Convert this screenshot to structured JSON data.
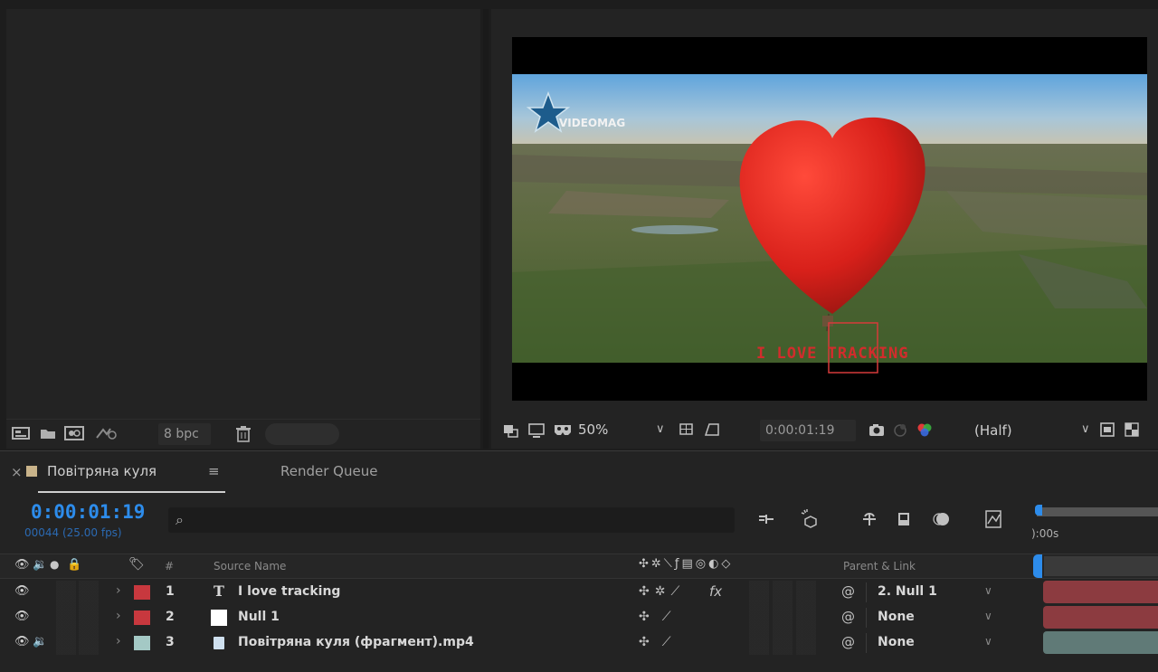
{
  "project_panel": {
    "toolbar": {
      "bpc_label": "8 bpc",
      "icons": [
        "interpret-footage-icon",
        "new-folder-icon",
        "new-composition-icon",
        "flowchart-icon",
        "trash-icon"
      ]
    }
  },
  "viewer": {
    "frame": {
      "logo_text": "VIDEOMAG",
      "overlay_text": "I LOVE TRACKING"
    },
    "toolbar": {
      "zoom": "50%",
      "timecode": "0:00:01:19",
      "resolution": "(Half)"
    }
  },
  "timeline": {
    "tabs": [
      {
        "label": "Повітряна куля"
      },
      {
        "label": "Render Queue"
      }
    ],
    "current_time": "0:00:01:19",
    "frame_info": "00044 (25.00 fps)",
    "search_placeholder": "",
    "ruler_label": "):00s",
    "columns": {
      "number": "#",
      "source_name": "Source Name",
      "parent_link": "Parent & Link"
    },
    "layers": [
      {
        "number": "1",
        "type_icon": "T",
        "name": "I love tracking",
        "label_color": "#c8383e",
        "parent": "2. Null 1",
        "audio": false,
        "switch_fx": "fx"
      },
      {
        "number": "2",
        "type_icon": "",
        "name": "Null 1",
        "label_color": "#c8383e",
        "parent": "None",
        "audio": false,
        "switch_fx": ""
      },
      {
        "number": "3",
        "type_icon": "",
        "name": "Повітряна куля (фрагмент).mp4",
        "label_color": "#a4c9c5",
        "parent": "None",
        "audio": true,
        "switch_fx": ""
      }
    ],
    "colors": {
      "accent": "#2d8ceb",
      "layer_bar_red": "#8c3b40",
      "layer_bar_teal": "#607a77"
    }
  }
}
